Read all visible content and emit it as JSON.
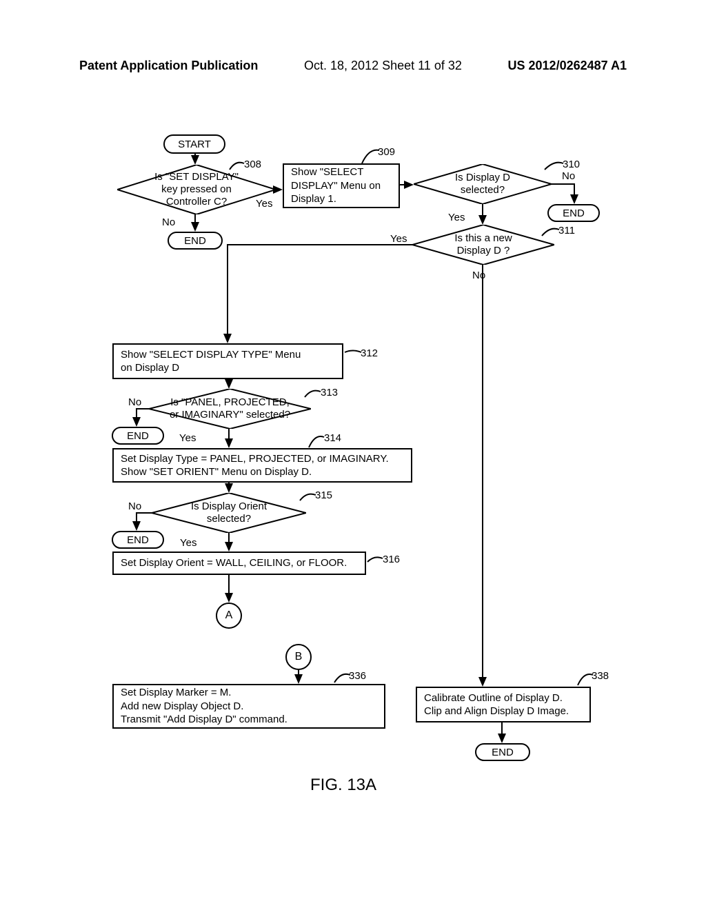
{
  "header": {
    "left": "Patent Application Publication",
    "center": "Oct. 18, 2012   Sheet 11 of 32",
    "right": "US 2012/0262487 A1"
  },
  "nodes": {
    "start": "START",
    "end1": "END",
    "end2": "END",
    "end3": "END",
    "end4": "END",
    "end5": "END",
    "d308": "Is \"SET DISPLAY\"\nkey pressed on\nController C?",
    "p309": "Show \"SELECT\nDISPLAY\" Menu on\nDisplay 1.",
    "d310": "Is Display D\nselected?",
    "d311": "Is this a new\nDisplay D ?",
    "p312": "Show \"SELECT DISPLAY TYPE\" Menu\non Display D",
    "d313": "Is \"PANEL, PROJECTED,\nor IMAGINARY\" selected?",
    "p314": "Set Display Type = PANEL, PROJECTED, or IMAGINARY.\nShow \"SET ORIENT\" Menu on Display D.",
    "d315": "Is Display Orient\nselected?",
    "p316": "Set Display Orient = WALL, CEILING, or FLOOR.",
    "connectorA": "A",
    "connectorB": "B",
    "p336": "Set Display Marker = M.\nAdd new Display Object D.\nTransmit \"Add Display D\" command.",
    "p338": "Calibrate Outline of Display D.\nClip and Align Display D Image."
  },
  "refs": {
    "r308": "308",
    "r309": "309",
    "r310": "310",
    "r311": "311",
    "r312": "312",
    "r313": "313",
    "r314": "314",
    "r315": "315",
    "r316": "316",
    "r336": "336",
    "r338": "338"
  },
  "labels": {
    "yes": "Yes",
    "no": "No"
  },
  "figure": "FIG. 13A"
}
